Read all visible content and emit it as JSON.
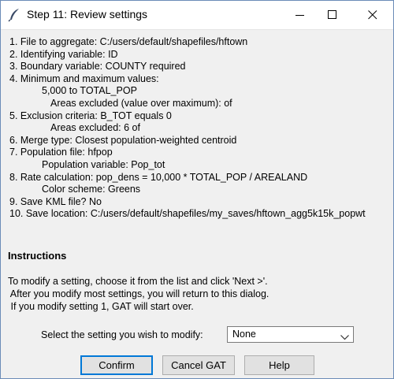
{
  "window": {
    "title": "Step 11: Review settings"
  },
  "settings": [
    "1. File to aggregate: C:/users/default/shapefiles/hftown",
    "2. Identifying variable: ID",
    "3. Boundary variable: COUNTY required",
    "4. Minimum and maximum values:",
    "5,000 to  TOTAL_POP",
    "Areas excluded (value over maximum):  of",
    "5. Exclusion criteria: B_TOT equals 0",
    "Areas excluded: 6 of",
    "6. Merge type: Closest population-weighted centroid",
    "7. Population file: hfpop",
    "Population variable: Pop_tot",
    "8. Rate calculation: pop_dens = 10,000 * TOTAL_POP / AREALAND",
    "Color scheme: Greens",
    "9. Save KML file? No",
    "10. Save location: C:/users/default/shapefiles/my_saves/hftown_agg5k15k_popwt"
  ],
  "instructions": {
    "heading": "Instructions",
    "lines": [
      "To modify a setting, choose it from the list and click 'Next >'.",
      " After you modify most settings, you will return to this dialog.",
      " If you modify setting 1, GAT will start over."
    ]
  },
  "modify": {
    "label": "Select the setting you wish to modify:",
    "selected": "None"
  },
  "buttons": {
    "confirm": "Confirm",
    "cancel": "Cancel GAT",
    "help": "Help"
  },
  "icons": {
    "app": "feather-icon",
    "minimize": "minimize-icon",
    "maximize": "maximize-icon",
    "close": "close-icon",
    "dropdown": "chevron-down-icon"
  }
}
